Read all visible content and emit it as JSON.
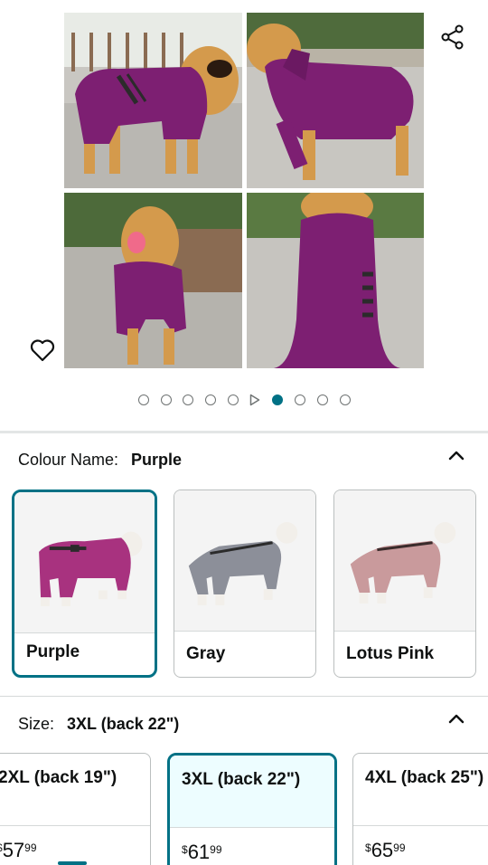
{
  "gallery": {
    "images": [
      "dog-coat-side-view",
      "dog-coat-back-angle",
      "dog-coat-front-view",
      "dog-coat-rear-view"
    ],
    "share_icon": "share-icon",
    "wishlist_icon": "heart-icon",
    "dots_total": 10,
    "video_dot_index": 5,
    "active_dot_index": 6
  },
  "colour": {
    "label": "Colour Name:",
    "selected": "Purple",
    "options": [
      {
        "name": "Purple",
        "color": "#a8327f",
        "selected": true
      },
      {
        "name": "Gray",
        "color": "#8c8f99",
        "selected": false
      },
      {
        "name": "Lotus Pink",
        "color": "#c99a9c",
        "selected": false
      }
    ]
  },
  "size": {
    "label": "Size:",
    "selected": "3XL (back 22\")",
    "options": [
      {
        "name": "2XL (back 19\")",
        "currency": "$",
        "whole": "57",
        "fraction": "99",
        "selected": false
      },
      {
        "name": "3XL (back 22\")",
        "currency": "$",
        "whole": "61",
        "fraction": "99",
        "selected": true
      },
      {
        "name": "4XL (back 25\")",
        "currency": "$",
        "whole": "65",
        "fraction": "99",
        "selected": false
      }
    ]
  },
  "colors": {
    "accent": "#007185",
    "coat_purple": "#7d1f72",
    "dog_fur": "#d49a4c"
  }
}
